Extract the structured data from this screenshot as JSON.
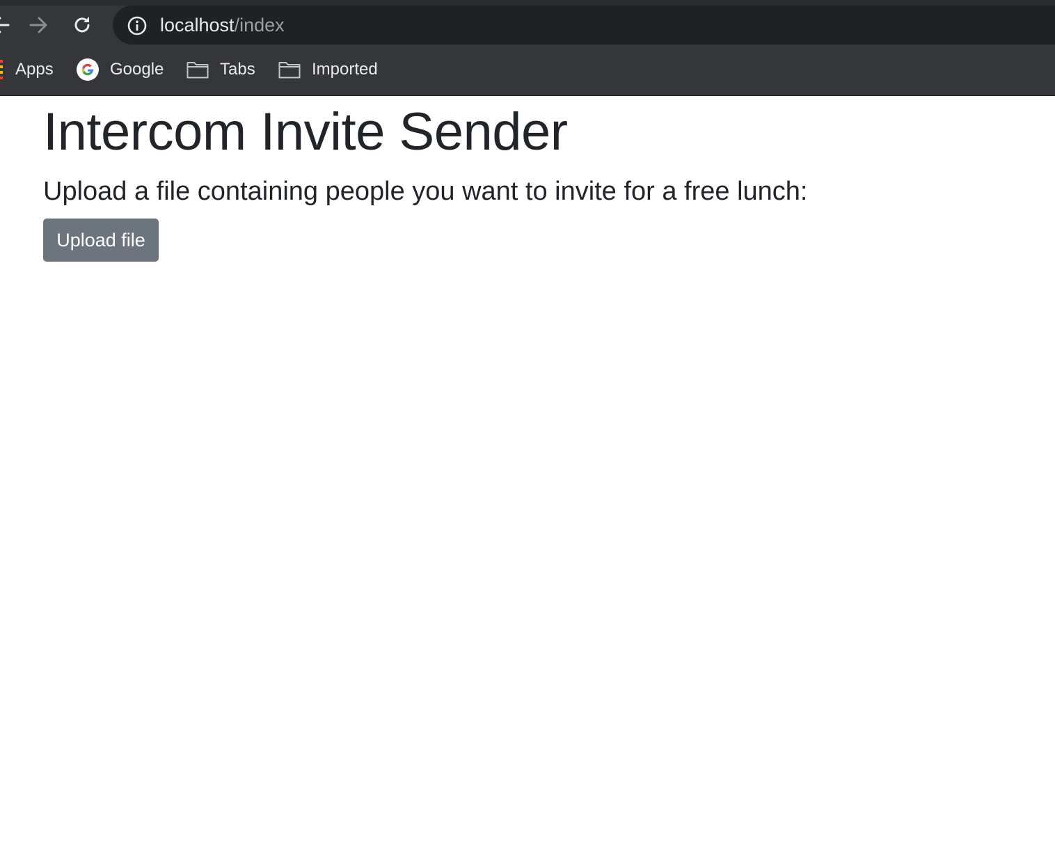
{
  "browser": {
    "url_host": "localhost",
    "url_path": "/index",
    "bookmarks": [
      {
        "label": "Apps",
        "icon": "apps-grid-icon"
      },
      {
        "label": "Google",
        "icon": "google-icon"
      },
      {
        "label": "Tabs",
        "icon": "folder-icon"
      },
      {
        "label": "Imported",
        "icon": "folder-icon"
      }
    ]
  },
  "page": {
    "title": "Intercom Invite Sender",
    "subtitle": "Upload a file containing people you want to invite for a free lunch:",
    "upload_button_label": "Upload file"
  },
  "colors": {
    "chrome_bg": "#35363a",
    "omnibox_bg": "#202124",
    "text_dark": "#212529",
    "button_bg": "#6c757d"
  }
}
